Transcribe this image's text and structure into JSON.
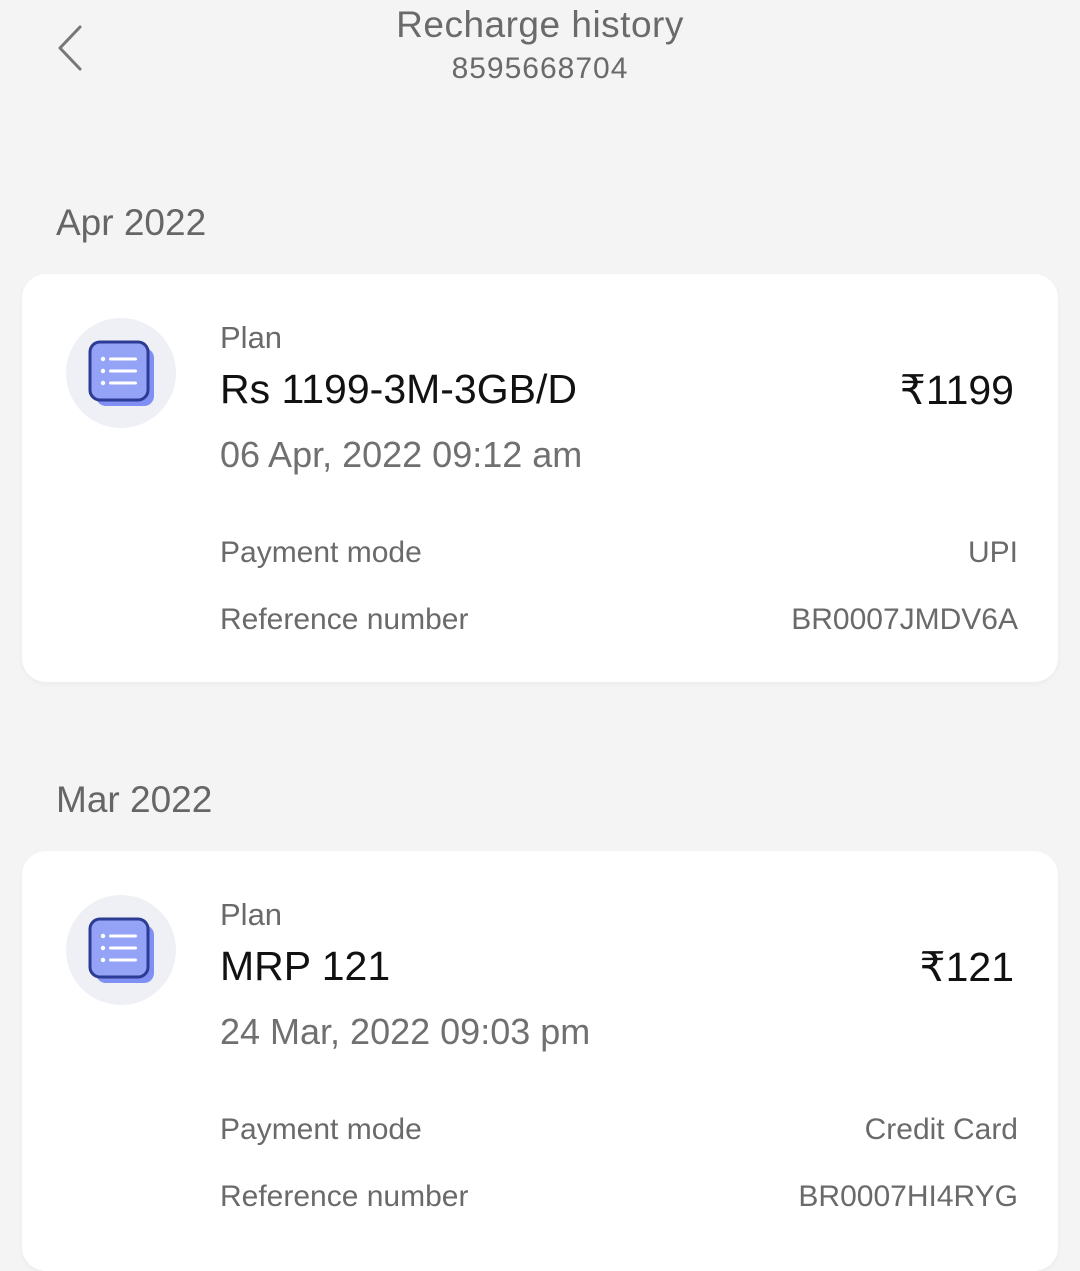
{
  "header": {
    "title": "Recharge history",
    "subtitle": "8595668704",
    "back_icon": "chevron-left-icon"
  },
  "sections": [
    {
      "month": "Apr 2022",
      "card": {
        "icon": "list-document-icon",
        "plan_caption": "Plan",
        "plan_name": "Rs 1199-3M-3GB/D",
        "amount": "₹1199",
        "date": "06 Apr, 2022 09:12 am",
        "payment_mode_label": "Payment mode",
        "payment_mode_value": "UPI",
        "reference_label": "Reference number",
        "reference_value": "BR0007JMDV6A"
      }
    },
    {
      "month": "Mar 2022",
      "card": {
        "icon": "list-document-icon",
        "plan_caption": "Plan",
        "plan_name": "MRP 121",
        "amount": "₹121",
        "date": "24 Mar, 2022 09:03 pm",
        "payment_mode_label": "Payment mode",
        "payment_mode_value": "Credit Card",
        "reference_label": "Reference number",
        "reference_value": "BR0007HI4RYG"
      }
    }
  ],
  "colors": {
    "background": "#f4f4f4",
    "card": "#ffffff",
    "icon_circle": "#eef0f6",
    "icon_fill": "#7f8ff4",
    "icon_stroke": "#2c3b93"
  }
}
